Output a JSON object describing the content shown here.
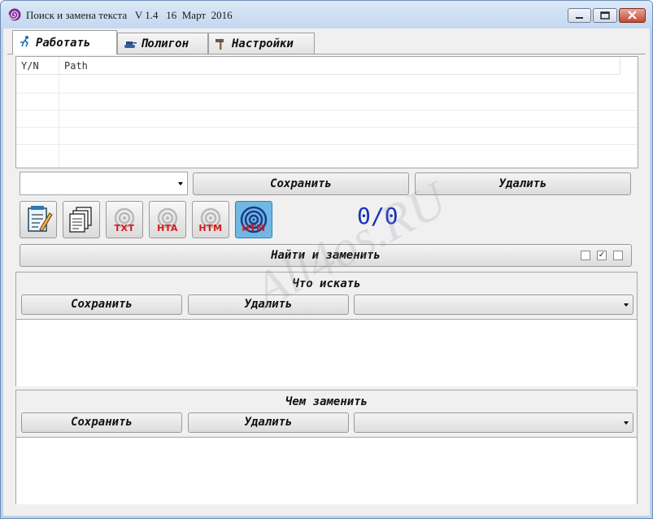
{
  "window": {
    "title": "Поиск и замена текста   V 1.4   16  Март  2016",
    "accent": "#c3d7ef"
  },
  "tabs": [
    {
      "label": "Работать",
      "icon": "runner-icon",
      "active": true
    },
    {
      "label": "Полигон",
      "icon": "tank-icon",
      "active": false
    },
    {
      "label": "Настройки",
      "icon": "hammer-icon",
      "active": false
    }
  ],
  "filelist": {
    "columns": [
      "Y/N",
      "Path"
    ]
  },
  "profile": {
    "combo_value": "",
    "save_label": "Сохранить",
    "delete_label": "Удалить"
  },
  "toolbar": {
    "buttons": [
      {
        "name": "notepad-edit-icon",
        "label": ""
      },
      {
        "name": "documents-stack-icon",
        "label": ""
      },
      {
        "name": "txt-spiral-icon",
        "label": "TXT"
      },
      {
        "name": "hta-spiral-icon",
        "label": "HTA"
      },
      {
        "name": "htm-spiral-icon",
        "label": "HTM"
      },
      {
        "name": "spiral-icon",
        "label": "HTM"
      }
    ],
    "counter": "0/0"
  },
  "find_replace": {
    "label": "Найти и заменить",
    "checkboxes": [
      false,
      true,
      false
    ]
  },
  "search": {
    "title": "Что искать",
    "save_label": "Сохранить",
    "delete_label": "Удалить",
    "combo_value": ""
  },
  "replace": {
    "title": "Чем заменить",
    "save_label": "Сохранить",
    "delete_label": "Удалить",
    "combo_value": ""
  },
  "watermark": "All4os.RU"
}
